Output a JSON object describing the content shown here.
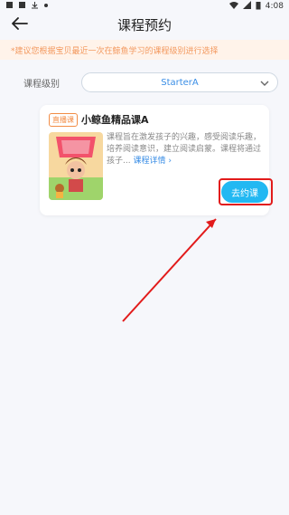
{
  "status": {
    "left_icons": [
      "notification-icon",
      "notification-icon",
      "download-icon",
      "dot-icon"
    ],
    "time": "4:08"
  },
  "header": {
    "title": "课程预约"
  },
  "notice": {
    "text": "*建议您根据宝贝最近一次在鲸鱼学习的课程级别进行选择"
  },
  "filter": {
    "label": "课程级别",
    "selected": "StarterA"
  },
  "course": {
    "badge": "直播课",
    "name": "小鲸鱼精品课A",
    "description": "课程旨在激发孩子的兴趣，感受阅读乐趣，培养阅读意识，建立阅读启蒙。课程将通过孩子...",
    "details_link": "课程详情",
    "book_button": "去约课"
  },
  "colors": {
    "accent": "#22b8f2",
    "link": "#3a8ee6",
    "notice_bg": "#fff3ea",
    "notice_text": "#f39a60",
    "annotation": "#e21b1b"
  }
}
